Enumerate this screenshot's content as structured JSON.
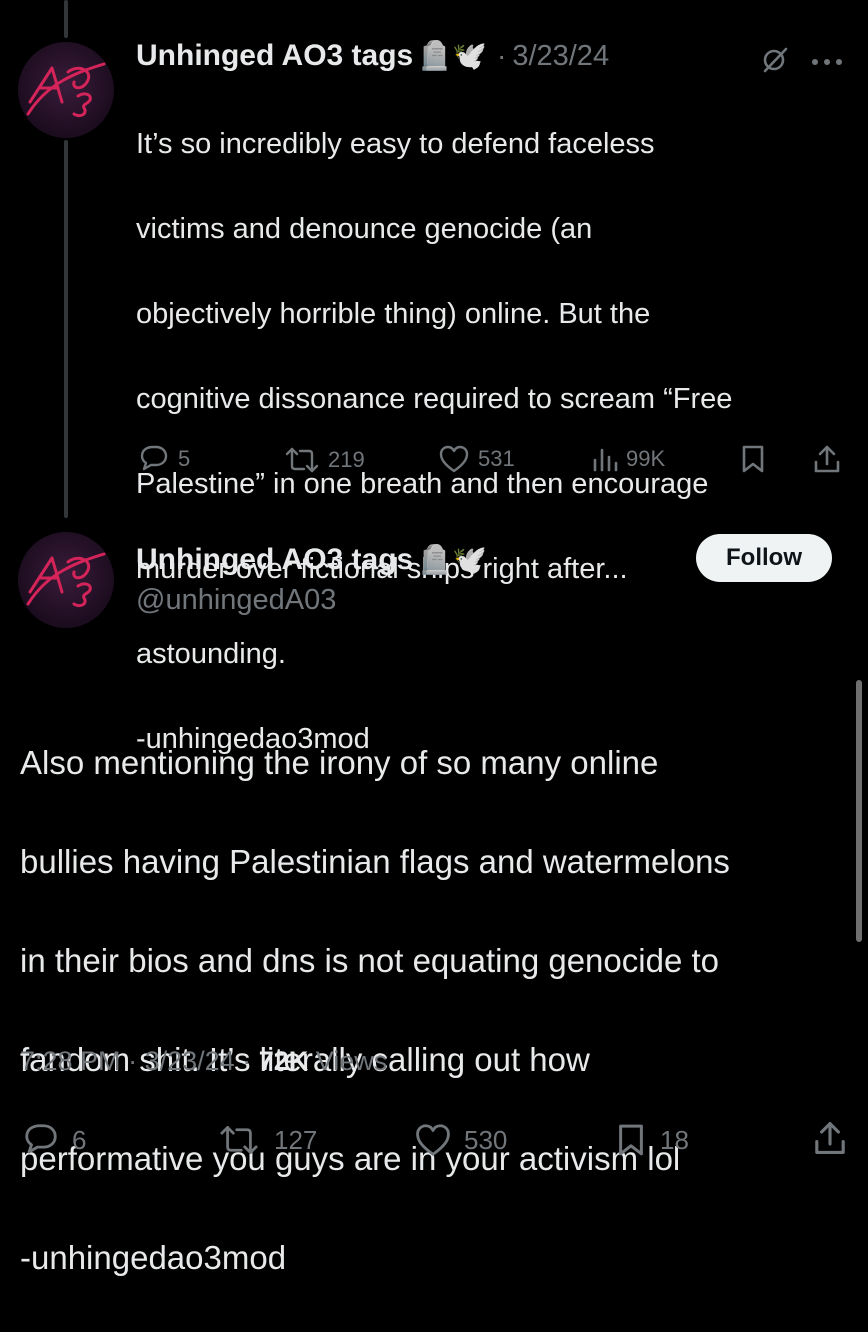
{
  "reply_tweet": {
    "author_name": "Unhinged AO3 tags",
    "author_emojis": "🪦🕊️",
    "date": "3/23/24",
    "separator": "·",
    "text_lines": [
      "It’s so incredibly easy to defend faceless",
      "victims and denounce genocide (an",
      "objectively horrible thing) online. But the",
      "cognitive dissonance required to scream “Free",
      "Palestine” in one breath and then encourage",
      "murder over fictional ships right after...",
      "astounding.",
      "-unhingedao3mod"
    ],
    "replies": "5",
    "reposts": "219",
    "likes": "531",
    "views": "99K"
  },
  "main_tweet": {
    "author_name": "Unhinged AO3 tags",
    "author_emojis": "🪦🕊️",
    "handle": "@unhingedA03",
    "follow_label": "Follow",
    "text_lines": [
      "Also mentioning the irony of so many online",
      "bullies having Palestinian flags and watermelons",
      "in their bios and dns is not equating genocide to",
      "fandom shit. It’s literally calling out how",
      "performative you guys are in your activism lol",
      "-unhingedao3mod"
    ],
    "time": "7:28 PM",
    "date": "3/23/24",
    "views_count": "72K",
    "views_label": "Views",
    "replies": "6",
    "reposts": "127",
    "likes": "530",
    "bookmarks": "18"
  },
  "icons": {
    "reply": "reply-icon",
    "repost": "repost-icon",
    "like": "heart-icon",
    "views": "views-chart-icon",
    "bookmark": "bookmark-icon",
    "share": "share-icon",
    "grok": "grok-icon",
    "more": "more-icon"
  },
  "colors": {
    "background": "#000000",
    "text": "#e7e9ea",
    "secondary": "#71767b",
    "follow_bg": "#eff3f4"
  }
}
